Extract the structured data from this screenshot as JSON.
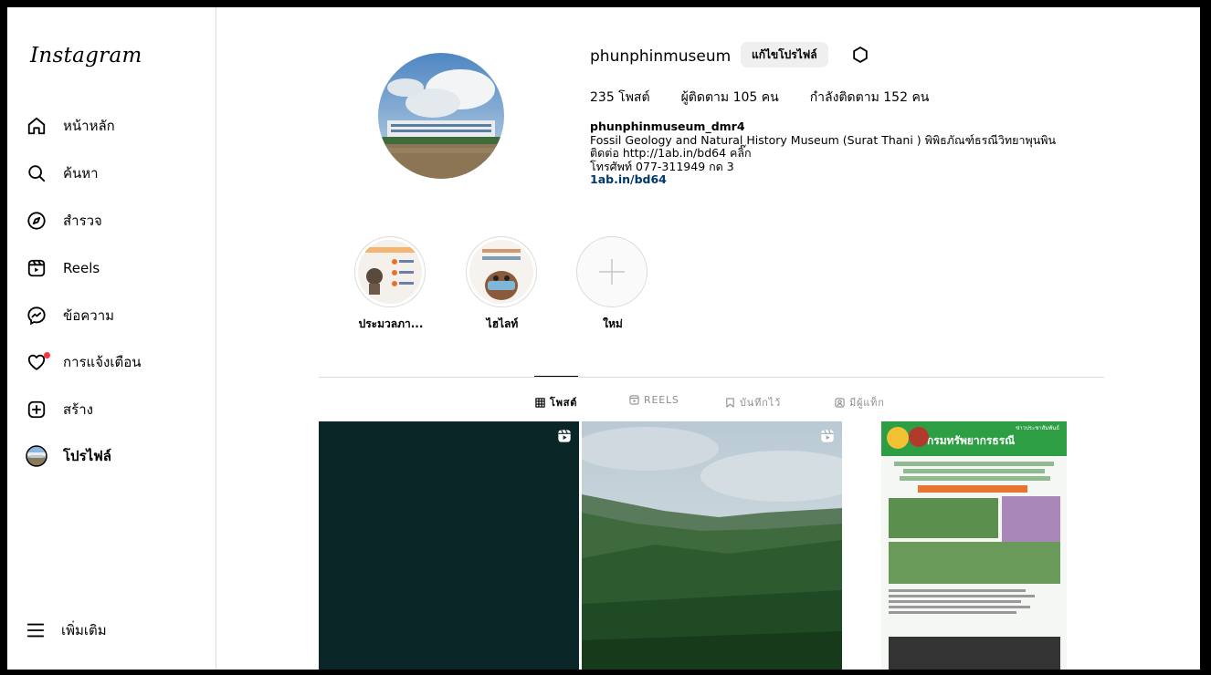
{
  "sidebar": {
    "logo": "Instagram",
    "items": [
      {
        "label": "หน้าหลัก",
        "icon": "home-icon"
      },
      {
        "label": "ค้นหา",
        "icon": "search-icon"
      },
      {
        "label": "สำรวจ",
        "icon": "explore-icon"
      },
      {
        "label": "Reels",
        "icon": "reels-icon"
      },
      {
        "label": "ข้อความ",
        "icon": "messenger-icon"
      },
      {
        "label": "การแจ้งเตือน",
        "icon": "heart-icon"
      },
      {
        "label": "สร้าง",
        "icon": "create-icon"
      },
      {
        "label": "โปรไฟล์",
        "icon": "profile-avatar-icon"
      }
    ],
    "more_label": "เพิ่มเติม"
  },
  "profile": {
    "username": "phunphinmuseum",
    "edit_label": "แก้ไขโปรไฟล์",
    "posts": "235 โพสต์",
    "followers": "ผู้ติดตาม 105 คน",
    "following": "กำลังติดตาม 152 คน",
    "bio_name": "phunphinmuseum_dmr4",
    "bio_line1": "Fossil Geology and Natural History Museum (Surat Thani ) พิพิธภัณฑ์ธรณีวิทยาพุนพิน",
    "bio_line2": "ติดต่อ http://1ab.in/bd64 คลิ๊ก",
    "bio_line3": "โทรศัพท์ 077-311949 กด 3",
    "bio_link": "1ab.in/bd64"
  },
  "highlights": [
    {
      "label": "ประมวลภา..."
    },
    {
      "label": "ไฮไลท์"
    },
    {
      "label": "ใหม่"
    }
  ],
  "tabs": [
    {
      "label": "โพสต์",
      "icon": "grid-icon"
    },
    {
      "label": "REELS",
      "icon": "reels-tab-icon"
    },
    {
      "label": "บันทึกไว้",
      "icon": "bookmark-icon"
    },
    {
      "label": "มีผู้แท็ก",
      "icon": "tagged-icon"
    }
  ],
  "posts_grid": {
    "post3_title": "กรมทรัพยากรธรณี",
    "post3_kicker": "ข่าวประชาสัมพันธ์"
  },
  "colors": {
    "accent_link": "#00376b",
    "notification_dot": "#ff3040",
    "poster_green": "#2e9e44"
  }
}
